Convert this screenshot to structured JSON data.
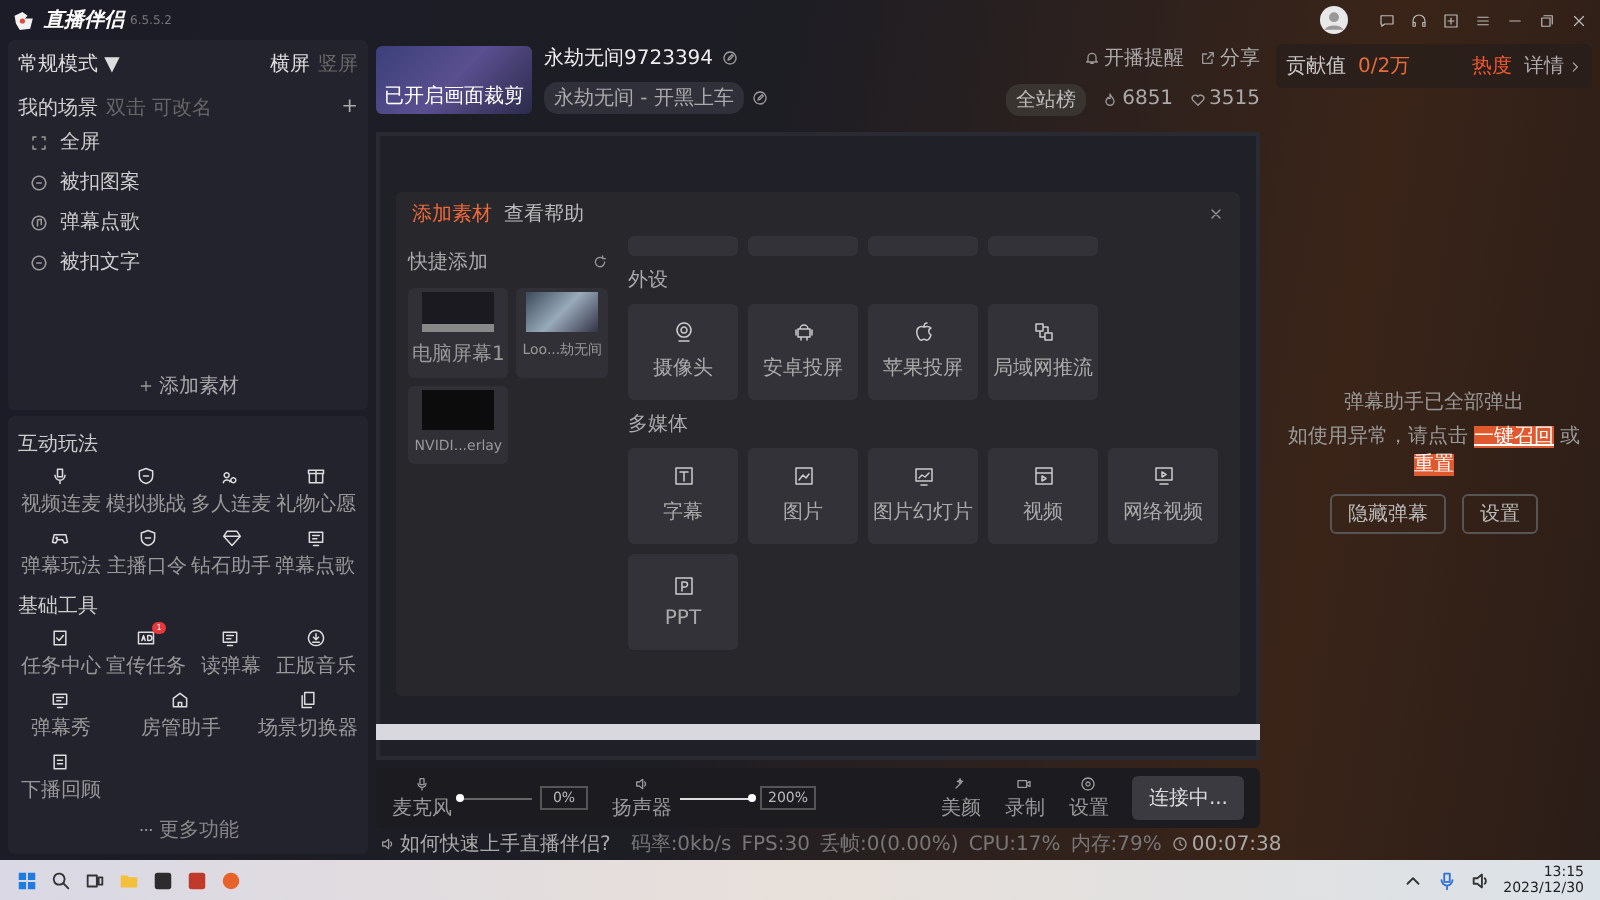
{
  "app": {
    "name": "直播伴侣",
    "version": "6.5.5.2"
  },
  "mode": {
    "label": "常规模式",
    "caret": "▼"
  },
  "orientations": [
    {
      "label": "横屏",
      "selected": true
    },
    {
      "label": "竖屏",
      "selected": false
    }
  ],
  "scenes": {
    "title": "我的场景",
    "hint": "双击 可改名",
    "add": "+",
    "add_material": "添加素材",
    "items": [
      {
        "label": "全屏",
        "kind": "frame"
      },
      {
        "label": "被扣图案",
        "kind": "circle"
      },
      {
        "label": "弹幕点歌",
        "kind": "note"
      },
      {
        "label": "被扣文字",
        "kind": "circle"
      }
    ]
  },
  "interactive": {
    "title": "互动玩法",
    "items": [
      {
        "label": "视频连麦",
        "kind": "mic"
      },
      {
        "label": "模拟挑战",
        "kind": "shield"
      },
      {
        "label": "多人连麦",
        "kind": "people"
      },
      {
        "label": "礼物心愿",
        "kind": "gift"
      },
      {
        "label": "弹幕玩法",
        "kind": "game"
      },
      {
        "label": "主播口令",
        "kind": "shield"
      },
      {
        "label": "钻石助手",
        "kind": "diamond"
      },
      {
        "label": "弹幕点歌",
        "kind": "screen"
      }
    ]
  },
  "tools": {
    "title": "基础工具",
    "more": "更多功能",
    "items": [
      {
        "label": "任务中心",
        "kind": "check"
      },
      {
        "label": "宣传任务",
        "kind": "ad",
        "badge": "1"
      },
      {
        "label": "读弹幕",
        "kind": "screen"
      },
      {
        "label": "正版音乐",
        "kind": "download"
      },
      {
        "label": "弹幕秀",
        "kind": "screen"
      },
      {
        "label": "房管助手",
        "kind": "house"
      },
      {
        "label": "场景切换器",
        "kind": "copy"
      },
      {
        "label": "下播回顾",
        "kind": "doc"
      }
    ]
  },
  "room": {
    "caption": "已开启画面裁剪",
    "title": "永劫无间9723394",
    "category": "永劫无间 - 开黑上车"
  },
  "actions": [
    {
      "label": "开播提醒",
      "kind": "bell"
    },
    {
      "label": "分享",
      "kind": "share"
    }
  ],
  "stats": {
    "rank": "全站榜",
    "fire": "6851",
    "likes": "3515"
  },
  "contribution": {
    "label": "贡献值",
    "value": "0/2万",
    "heat": "热度",
    "details": "详情"
  },
  "dialog": {
    "tabs": [
      {
        "label": "添加素材",
        "selected": true
      },
      {
        "label": "查看帮助",
        "selected": false
      }
    ],
    "quick_title": "快捷添加",
    "quick": [
      {
        "label": "电脑屏幕1",
        "kind": "desktop"
      },
      {
        "label": "Loo...劫无间",
        "kind": "game"
      },
      {
        "label": "NVIDI...erlay",
        "kind": "black"
      }
    ],
    "sections": [
      {
        "title": "外设",
        "items": [
          {
            "label": "摄像头",
            "kind": "camera"
          },
          {
            "label": "安卓投屏",
            "kind": "android"
          },
          {
            "label": "苹果投屏",
            "kind": "apple"
          },
          {
            "label": "局域网推流",
            "kind": "lan"
          }
        ]
      },
      {
        "title": "多媒体",
        "items": [
          {
            "label": "字幕",
            "kind": "text"
          },
          {
            "label": "图片",
            "kind": "image"
          },
          {
            "label": "图片幻灯片",
            "kind": "slides"
          },
          {
            "label": "视频",
            "kind": "video"
          },
          {
            "label": "网络视频",
            "kind": "webvideo"
          },
          {
            "label": "PPT",
            "kind": "ppt"
          }
        ]
      }
    ]
  },
  "helper": {
    "line1": "弹幕助手已全部弹出",
    "prefix": "如使用异常，请点击",
    "recall": "一键召回",
    "or": "或",
    "reset": "重置",
    "buttons": [
      "隐藏弹幕",
      "设置"
    ]
  },
  "audio": [
    {
      "label": "麦克风",
      "kind": "mic",
      "level": 0.0,
      "reading": "0%"
    },
    {
      "label": "扬声器",
      "kind": "speaker",
      "level": 1.0,
      "reading": "200%"
    }
  ],
  "controls": [
    {
      "label": "美颜",
      "kind": "beauty"
    },
    {
      "label": "录制",
      "kind": "record"
    },
    {
      "label": "设置",
      "kind": "settings"
    }
  ],
  "connect": "连接中...",
  "help_link": "如何快速上手直播伴侣?",
  "status": [
    "码率:0kb/s",
    "FPS:30",
    "丢帧:0(0.00%)",
    "CPU:17%",
    "内存:79%"
  ],
  "timer": "00:07:38",
  "taskbar": {
    "time": "13:15",
    "date": "2023/12/30"
  }
}
